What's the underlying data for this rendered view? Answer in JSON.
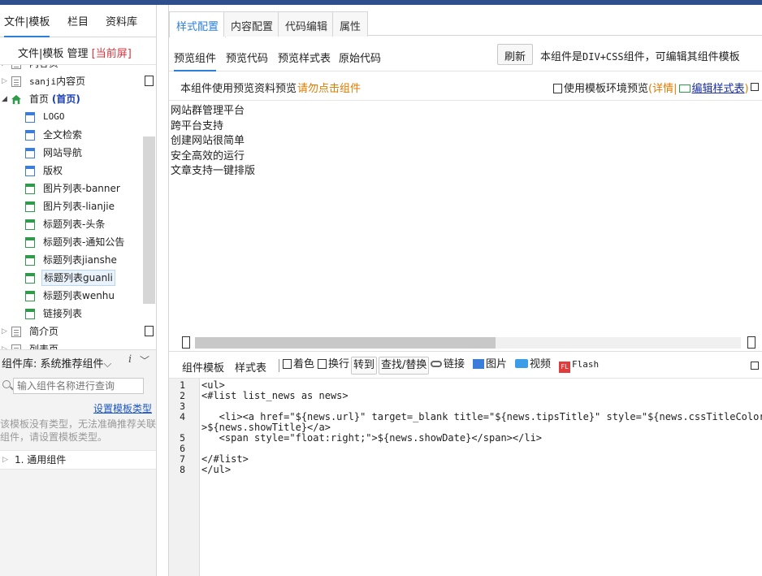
{
  "left": {
    "tabs": [
      "文件|模板",
      "栏目",
      "资料库"
    ],
    "sub": {
      "label": "文件|模板 管理",
      "current": "[当前屏]"
    },
    "tree": [
      {
        "label": "内容页",
        "kind": "doc",
        "indent": 0
      },
      {
        "label": "sanji内容页",
        "kind": "doc",
        "indent": 0,
        "mono_prefix": "sanji",
        "rest": "内容页"
      },
      {
        "label": "首页",
        "suffix": "(首页)",
        "kind": "home",
        "indent": 0
      },
      {
        "label": "LOGO",
        "kind": "blue",
        "indent": 1
      },
      {
        "label": "全文检索",
        "kind": "blue",
        "indent": 1
      },
      {
        "label": "网站导航",
        "kind": "blue",
        "indent": 1
      },
      {
        "label": "版权",
        "kind": "blue",
        "indent": 1
      },
      {
        "label": "图片列表-banner",
        "kind": "green",
        "indent": 1
      },
      {
        "label": "图片列表-lianjie",
        "kind": "green",
        "indent": 1
      },
      {
        "label": "标题列表-头条",
        "kind": "green",
        "indent": 1
      },
      {
        "label": "标题列表-通知公告",
        "kind": "green",
        "indent": 1
      },
      {
        "label": "标题列表jianshe",
        "kind": "green",
        "indent": 1
      },
      {
        "label": "标题列表guanli",
        "kind": "green",
        "indent": 1,
        "selected": true
      },
      {
        "label": "标题列表wenhu",
        "kind": "green",
        "indent": 1
      },
      {
        "label": "链接列表",
        "kind": "green",
        "indent": 1
      },
      {
        "label": "简介页",
        "kind": "doc",
        "indent": 0
      },
      {
        "label": "列表页",
        "kind": "doc",
        "indent": 0
      }
    ],
    "library": {
      "label": "组件库: 系统推荐组件",
      "info": "i"
    },
    "search": {
      "placeholder": "输入组件名称进行查询"
    },
    "set_type_link": "设置模板类型",
    "hint_lines": [
      "该模板没有类型，无法准确推荐关联",
      "组件，请设置模板类型。"
    ],
    "category": "1. 通用组件"
  },
  "tabs": [
    "样式配置",
    "内容配置",
    "代码编辑",
    "属性"
  ],
  "subtabs": [
    "预览组件",
    "预览代码",
    "预览样式表",
    "原始代码"
  ],
  "refresh_label": "刷新",
  "component_desc": {
    "pre": "本组件是",
    "mono": "DIV+CSS",
    "post": "组件，可编辑其组件模板"
  },
  "preview_bar": {
    "text": "本组件使用预览资料预览",
    "click_hint": "请勿点击组件",
    "env_label": "使用模板环境预览",
    "detail_open": "(",
    "detail": "详情",
    "pipe": "|",
    "edit_style": "编辑样式表",
    "close_paren": ")"
  },
  "preview_items": [
    "网站群管理平台",
    "跨平台支持",
    "创建网站很简单",
    "安全高效的运行",
    "文章支持一键排版"
  ],
  "code_tabs": [
    "组件模板",
    "样式表"
  ],
  "toolbar": {
    "color": "着色",
    "wrap": "换行",
    "goto": "转到",
    "find": "查找/替换",
    "link": "链接",
    "image": "图片",
    "video": "视频",
    "flash": "Flash",
    "flash_badge": "FL"
  },
  "code_lines": [
    {
      "n": "1",
      "text": "<ul>"
    },
    {
      "n": "2",
      "text": "<#list list_news as news>"
    },
    {
      "n": "3",
      "text": ""
    },
    {
      "n": "4",
      "text": "   <li><a href=\"${news.url}\" target=_blank title=\"${news.tipsTitle}\" style=\"${news.cssTitleColor}\""
    },
    {
      "n": "",
      "text": ">${news.showTitle}</a>"
    },
    {
      "n": "5",
      "text": "   <span style=\"float:right;\">${news.showDate}</span></li>"
    },
    {
      "n": "6",
      "text": ""
    },
    {
      "n": "7",
      "text": "</#list>"
    },
    {
      "n": "8",
      "text": "</ul>"
    }
  ],
  "colors": {
    "accent": "#2e7fd8",
    "warning": "#e07b00",
    "current_screen": "#d9363e",
    "top_bar": "#2f4e8c"
  }
}
